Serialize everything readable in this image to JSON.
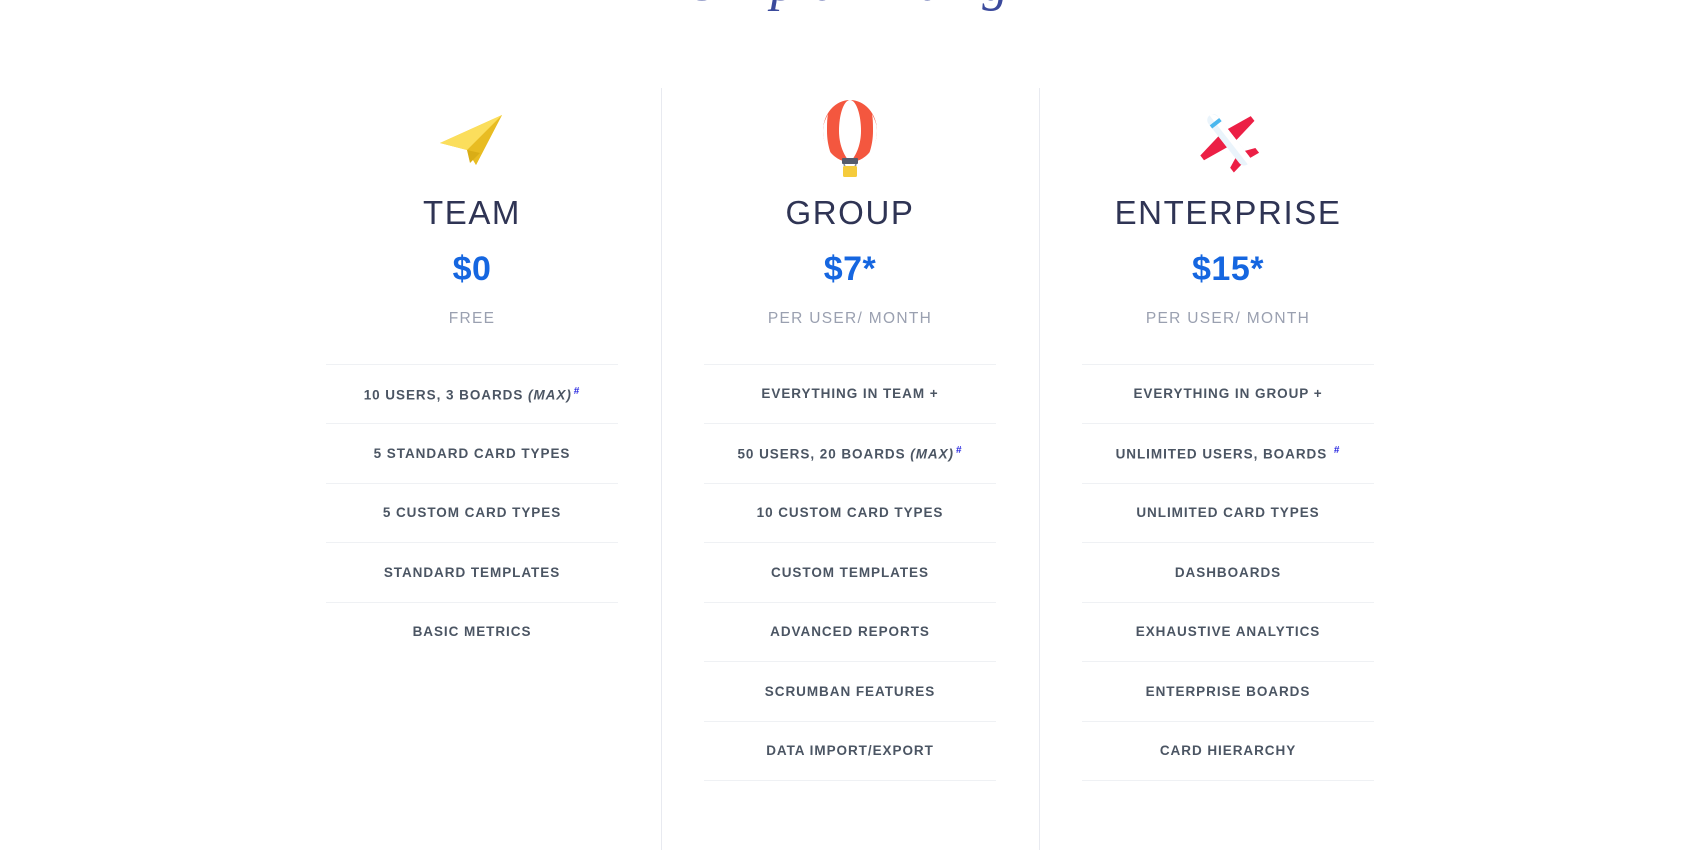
{
  "heading": "Simple Pricing",
  "colors": {
    "price_blue": "#1566e0",
    "plan_name": "#2f3454",
    "period_gray": "#9aa0b0",
    "feature_text": "#4b5563",
    "divider": "#eff1f4",
    "hash_marker": "#2a2ae0"
  },
  "plans": [
    {
      "icon": "paper-plane-icon",
      "name": "TEAM",
      "price": "$0",
      "period": "FREE",
      "features": [
        {
          "text": "10 USERS, 3 BOARDS ",
          "italic": "(MAX)",
          "hash": "#"
        },
        {
          "text": "5 STANDARD CARD TYPES"
        },
        {
          "text": "5 CUSTOM CARD TYPES"
        },
        {
          "text": "STANDARD TEMPLATES"
        },
        {
          "text": "BASIC METRICS"
        }
      ]
    },
    {
      "icon": "hot-air-balloon-icon",
      "name": "GROUP",
      "price": "$7*",
      "period": "PER USER/ MONTH",
      "features": [
        {
          "text": "EVERYTHING IN TEAM +"
        },
        {
          "text": "50 USERS, 20 BOARDS ",
          "italic": "(MAX)",
          "hash": "#"
        },
        {
          "text": "10 CUSTOM CARD TYPES"
        },
        {
          "text": "CUSTOM TEMPLATES"
        },
        {
          "text": "ADVANCED REPORTS"
        },
        {
          "text": "SCRUMBAN FEATURES"
        },
        {
          "text": "DATA IMPORT/EXPORT"
        },
        {
          "text": ""
        }
      ]
    },
    {
      "icon": "airplane-icon",
      "name": "ENTERPRISE",
      "price": "$15*",
      "period": "PER USER/ MONTH",
      "features": [
        {
          "text": "EVERYTHING IN GROUP +"
        },
        {
          "text": "UNLIMITED USERS, BOARDS ",
          "hash": "#"
        },
        {
          "text": "UNLIMITED CARD TYPES"
        },
        {
          "text": "DASHBOARDS"
        },
        {
          "text": "EXHAUSTIVE ANALYTICS"
        },
        {
          "text": "ENTERPRISE BOARDS"
        },
        {
          "text": "CARD HIERARCHY"
        },
        {
          "text": ""
        }
      ]
    }
  ]
}
